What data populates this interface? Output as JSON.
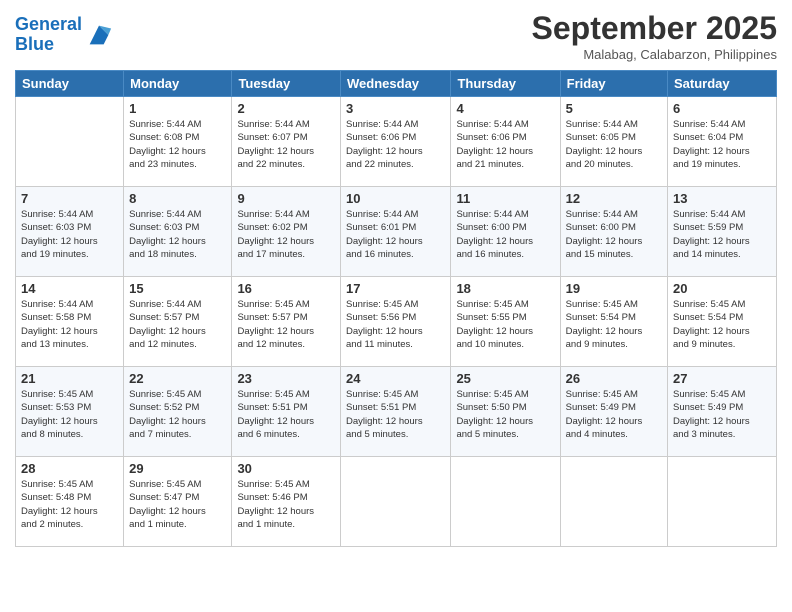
{
  "header": {
    "logo_line1": "General",
    "logo_line2": "Blue",
    "month": "September 2025",
    "location": "Malabag, Calabarzon, Philippines"
  },
  "weekdays": [
    "Sunday",
    "Monday",
    "Tuesday",
    "Wednesday",
    "Thursday",
    "Friday",
    "Saturday"
  ],
  "weeks": [
    [
      {
        "day": "",
        "info": ""
      },
      {
        "day": "1",
        "info": "Sunrise: 5:44 AM\nSunset: 6:08 PM\nDaylight: 12 hours\nand 23 minutes."
      },
      {
        "day": "2",
        "info": "Sunrise: 5:44 AM\nSunset: 6:07 PM\nDaylight: 12 hours\nand 22 minutes."
      },
      {
        "day": "3",
        "info": "Sunrise: 5:44 AM\nSunset: 6:06 PM\nDaylight: 12 hours\nand 22 minutes."
      },
      {
        "day": "4",
        "info": "Sunrise: 5:44 AM\nSunset: 6:06 PM\nDaylight: 12 hours\nand 21 minutes."
      },
      {
        "day": "5",
        "info": "Sunrise: 5:44 AM\nSunset: 6:05 PM\nDaylight: 12 hours\nand 20 minutes."
      },
      {
        "day": "6",
        "info": "Sunrise: 5:44 AM\nSunset: 6:04 PM\nDaylight: 12 hours\nand 19 minutes."
      }
    ],
    [
      {
        "day": "7",
        "info": "Sunrise: 5:44 AM\nSunset: 6:03 PM\nDaylight: 12 hours\nand 19 minutes."
      },
      {
        "day": "8",
        "info": "Sunrise: 5:44 AM\nSunset: 6:03 PM\nDaylight: 12 hours\nand 18 minutes."
      },
      {
        "day": "9",
        "info": "Sunrise: 5:44 AM\nSunset: 6:02 PM\nDaylight: 12 hours\nand 17 minutes."
      },
      {
        "day": "10",
        "info": "Sunrise: 5:44 AM\nSunset: 6:01 PM\nDaylight: 12 hours\nand 16 minutes."
      },
      {
        "day": "11",
        "info": "Sunrise: 5:44 AM\nSunset: 6:00 PM\nDaylight: 12 hours\nand 16 minutes."
      },
      {
        "day": "12",
        "info": "Sunrise: 5:44 AM\nSunset: 6:00 PM\nDaylight: 12 hours\nand 15 minutes."
      },
      {
        "day": "13",
        "info": "Sunrise: 5:44 AM\nSunset: 5:59 PM\nDaylight: 12 hours\nand 14 minutes."
      }
    ],
    [
      {
        "day": "14",
        "info": "Sunrise: 5:44 AM\nSunset: 5:58 PM\nDaylight: 12 hours\nand 13 minutes."
      },
      {
        "day": "15",
        "info": "Sunrise: 5:44 AM\nSunset: 5:57 PM\nDaylight: 12 hours\nand 12 minutes."
      },
      {
        "day": "16",
        "info": "Sunrise: 5:45 AM\nSunset: 5:57 PM\nDaylight: 12 hours\nand 12 minutes."
      },
      {
        "day": "17",
        "info": "Sunrise: 5:45 AM\nSunset: 5:56 PM\nDaylight: 12 hours\nand 11 minutes."
      },
      {
        "day": "18",
        "info": "Sunrise: 5:45 AM\nSunset: 5:55 PM\nDaylight: 12 hours\nand 10 minutes."
      },
      {
        "day": "19",
        "info": "Sunrise: 5:45 AM\nSunset: 5:54 PM\nDaylight: 12 hours\nand 9 minutes."
      },
      {
        "day": "20",
        "info": "Sunrise: 5:45 AM\nSunset: 5:54 PM\nDaylight: 12 hours\nand 9 minutes."
      }
    ],
    [
      {
        "day": "21",
        "info": "Sunrise: 5:45 AM\nSunset: 5:53 PM\nDaylight: 12 hours\nand 8 minutes."
      },
      {
        "day": "22",
        "info": "Sunrise: 5:45 AM\nSunset: 5:52 PM\nDaylight: 12 hours\nand 7 minutes."
      },
      {
        "day": "23",
        "info": "Sunrise: 5:45 AM\nSunset: 5:51 PM\nDaylight: 12 hours\nand 6 minutes."
      },
      {
        "day": "24",
        "info": "Sunrise: 5:45 AM\nSunset: 5:51 PM\nDaylight: 12 hours\nand 5 minutes."
      },
      {
        "day": "25",
        "info": "Sunrise: 5:45 AM\nSunset: 5:50 PM\nDaylight: 12 hours\nand 5 minutes."
      },
      {
        "day": "26",
        "info": "Sunrise: 5:45 AM\nSunset: 5:49 PM\nDaylight: 12 hours\nand 4 minutes."
      },
      {
        "day": "27",
        "info": "Sunrise: 5:45 AM\nSunset: 5:49 PM\nDaylight: 12 hours\nand 3 minutes."
      }
    ],
    [
      {
        "day": "28",
        "info": "Sunrise: 5:45 AM\nSunset: 5:48 PM\nDaylight: 12 hours\nand 2 minutes."
      },
      {
        "day": "29",
        "info": "Sunrise: 5:45 AM\nSunset: 5:47 PM\nDaylight: 12 hours\nand 1 minute."
      },
      {
        "day": "30",
        "info": "Sunrise: 5:45 AM\nSunset: 5:46 PM\nDaylight: 12 hours\nand 1 minute."
      },
      {
        "day": "",
        "info": ""
      },
      {
        "day": "",
        "info": ""
      },
      {
        "day": "",
        "info": ""
      },
      {
        "day": "",
        "info": ""
      }
    ]
  ]
}
